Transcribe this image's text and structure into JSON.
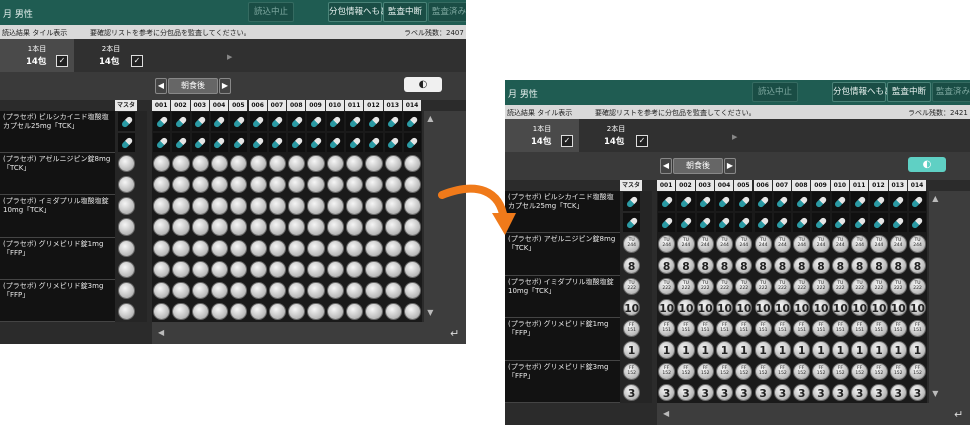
{
  "left": {
    "header": {
      "title": "月 男性",
      "buttons": [
        "読込中止",
        "分包情報へもどる",
        "監査中断",
        "監査済み"
      ]
    },
    "info": {
      "left": "読込結果 タイル表示",
      "center": "要確認リストを参考に分包品を監査してください。",
      "right": "ラベル残数：2407"
    },
    "tabs": [
      {
        "a": "1本目",
        "b": "14包"
      },
      {
        "a": "2本目",
        "b": "14包"
      }
    ],
    "toolbar": {
      "label": "朝食後",
      "toggle": "◐"
    },
    "master": "マスタ",
    "cols": [
      "001",
      "002",
      "003",
      "004",
      "005",
      "006",
      "007",
      "008",
      "009",
      "010",
      "011",
      "012",
      "013",
      "014"
    ],
    "drugs": [
      {
        "name": "(プラセボ) ピルシカイニド塩酸塩カプセル25mg「TCK」",
        "eye": "👁",
        "rows": 2,
        "code": []
      },
      {
        "name": "(プラセボ) アゼルニジピン錠8mg「TCK」",
        "rows": 2,
        "code": []
      },
      {
        "name": "(プラセボ) イミダプリル塩酸塩錠10mg「TCK」",
        "rows": 2,
        "code": []
      },
      {
        "name": "(プラセボ) グリメピリド錠1mg「FFP」",
        "rows": 2,
        "code": []
      },
      {
        "name": "(プラセボ) グリメピリド錠3mg「FFP」",
        "rows": 2,
        "code": []
      }
    ]
  },
  "right": {
    "header": {
      "title": "月 男性",
      "buttons": [
        "読込中止",
        "分包情報へもどる",
        "監査中断",
        "監査済み"
      ]
    },
    "info": {
      "left": "読込結果 タイル表示",
      "center": "要確認リストを参考に分包品を監査してください。",
      "right": "ラベル残数：2421"
    },
    "tabs": [
      {
        "a": "1本目",
        "b": "14包"
      },
      {
        "a": "2本目",
        "b": "14包"
      }
    ],
    "toolbar": {
      "label": "朝食後",
      "toggle": "◐"
    },
    "master": "マスタ",
    "cols": [
      "001",
      "002",
      "003",
      "004",
      "005",
      "006",
      "007",
      "008",
      "009",
      "010",
      "011",
      "012",
      "013",
      "014"
    ],
    "drugs": [
      {
        "name": "(プラセボ) ピルシカイニド塩酸塩カプセル25mg「TCK」",
        "rows": 2,
        "code": []
      },
      {
        "name": "(プラセボ) アゼルニジピン錠8mg「TCK」",
        "rows": 2,
        "code": [
          "TU",
          "244",
          "8"
        ]
      },
      {
        "name": "(プラセボ) イミダプリル塩酸塩錠10mg「TCK」",
        "rows": 2,
        "code": [
          "TU",
          "222",
          "10"
        ]
      },
      {
        "name": "(プラセボ) グリメピリド錠1mg「FFP」",
        "rows": 2,
        "code": [
          "FF",
          "151",
          "1"
        ]
      },
      {
        "name": "(プラセボ) グリメピリド錠3mg「FFP」",
        "rows": 2,
        "code": [
          "FF",
          "152",
          "3"
        ]
      }
    ]
  },
  "colors": {
    "header": "#1f5c52",
    "toggle_left": "#dddddd",
    "toggle_right": "#5fd0c4",
    "arrow": "#f07a1a"
  }
}
